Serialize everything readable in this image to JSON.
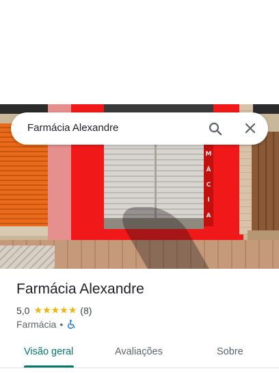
{
  "search": {
    "query": "Farmácia Alexandre"
  },
  "photo": {
    "sign_letters": [
      "M",
      "Á",
      "C",
      "I",
      "A"
    ]
  },
  "place": {
    "name": "Farmácia Alexandre",
    "rating": "5,0",
    "stars": 5,
    "review_count": "(8)",
    "category": "Farmácia",
    "separator": "•",
    "accessibility_icon": "wheelchair-icon"
  },
  "tabs": [
    {
      "label": "Visão geral",
      "active": true
    },
    {
      "label": "Avaliações",
      "active": false
    },
    {
      "label": "Sobre",
      "active": false
    }
  ],
  "colors": {
    "accent": "#00796b",
    "star": "#f6b400",
    "accessibility": "#1a73e8"
  }
}
